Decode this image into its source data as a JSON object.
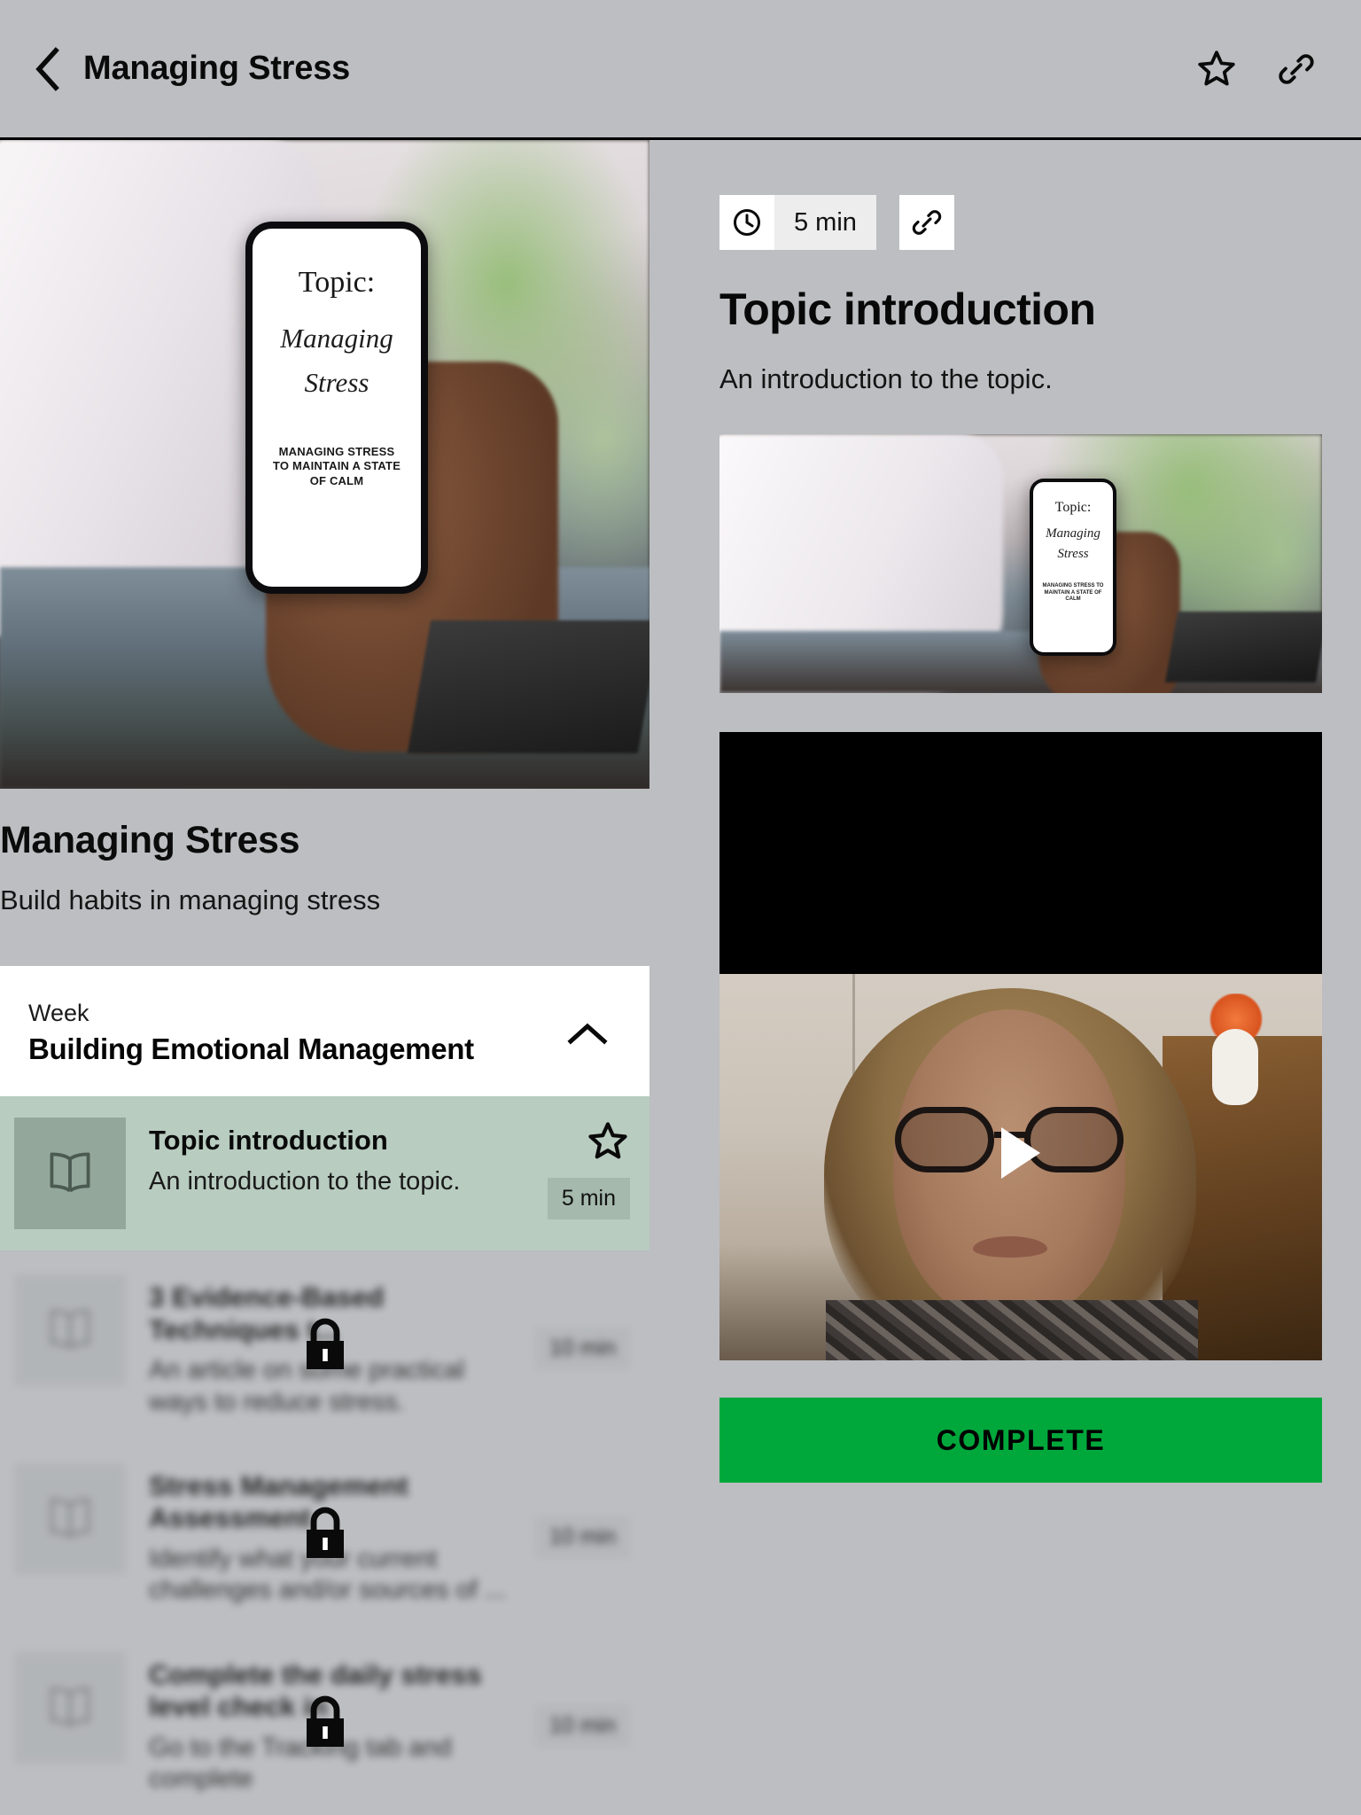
{
  "appbar": {
    "back_icon": "chevron-left-icon",
    "title": "Managing Stress",
    "star_icon": "star-outline-icon",
    "link_icon": "link-icon"
  },
  "course": {
    "hero_phone": {
      "topic_label": "Topic:",
      "script_line1": "Managing",
      "script_line2": "Stress",
      "caption": "MANAGING STRESS TO MAINTAIN A STATE OF CALM"
    },
    "title": "Managing Stress",
    "subtitle": "Build habits in managing stress"
  },
  "week": {
    "label": "Week",
    "name": "Building Emotional Management",
    "chevron_icon": "chevron-up-icon",
    "expanded": true
  },
  "topics": [
    {
      "name": "Topic introduction",
      "desc": "An introduction to the topic.",
      "duration": "5 min",
      "icon": "book-icon",
      "star_icon": "star-outline-icon",
      "active": true,
      "locked": false
    },
    {
      "name": "3 Evidence-Based Techniques t...",
      "desc": "An article on some practical ways to reduce stress.",
      "duration": "10 min",
      "icon": "book-icon",
      "lock_icon": "lock-icon",
      "active": false,
      "locked": true
    },
    {
      "name": "Stress Management Assessment",
      "desc": "Identify what your current challenges and/or sources of ...",
      "duration": "10 min",
      "icon": "book-icon",
      "lock_icon": "lock-icon",
      "active": false,
      "locked": true
    },
    {
      "name": "Complete the daily stress level check in",
      "desc": "Go to the Tracking tab and complete",
      "duration": "10 min",
      "icon": "book-icon",
      "lock_icon": "lock-icon",
      "active": false,
      "locked": true
    }
  ],
  "detail": {
    "clock_icon": "clock-icon",
    "duration": "5 min",
    "link_icon": "link-icon",
    "title": "Topic introduction",
    "description": "An introduction to the topic.",
    "thumb_phone": {
      "topic_label": "Topic:",
      "script_line1": "Managing",
      "script_line2": "Stress",
      "caption": "MANAGING STRESS TO MAINTAIN A STATE OF CALM"
    },
    "video": {
      "play_icon": "play-icon",
      "state": "paused"
    },
    "complete_label": "COMPLETE"
  },
  "colors": {
    "page_bg": "#bcbec1",
    "active_row": "#b8ccc0",
    "active_thumb": "#93a89b",
    "complete_green": "#00a83c",
    "card_white": "#ffffff"
  }
}
